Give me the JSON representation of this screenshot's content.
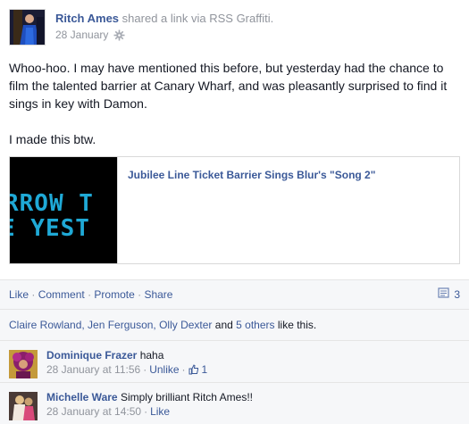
{
  "post": {
    "author": "Ritch Ames",
    "action_text": "shared a link via RSS Graffiti.",
    "date": "28 January",
    "paragraphs": [
      "Whoo-hoo. I may have mentioned this before, but yesterday had the chance to film the talented barrier at Canary Wharf, and was pleasantly surprised to find it sings in key with Damon.",
      "I made this btw."
    ]
  },
  "attachment": {
    "title": "Jubilee Line Ticket Barrier Sings Blur's \"Song 2\"",
    "thumb_line1": "RROW T",
    "thumb_line2": "E YEST"
  },
  "actions": {
    "like": "Like",
    "comment": "Comment",
    "promote": "Promote",
    "share": "Share",
    "separator": "·",
    "comment_count": "3"
  },
  "likes": {
    "names": "Claire Rowland, Jen Ferguson, Olly Dexter",
    "and": "and",
    "others": "5 others",
    "suffix": "like this."
  },
  "comments": [
    {
      "name": "Dominique Frazer",
      "text": "haha",
      "time": "28 January at 11:56",
      "action": "Unlike",
      "likes": "1"
    },
    {
      "name": "Michelle Ware",
      "text": "Simply brilliant Ritch Ames!!",
      "time": "28 January at 14:50",
      "action": "Like"
    }
  ],
  "colors": {
    "link": "#3b5998",
    "meta": "#90949c",
    "panel": "#f6f7f9"
  }
}
